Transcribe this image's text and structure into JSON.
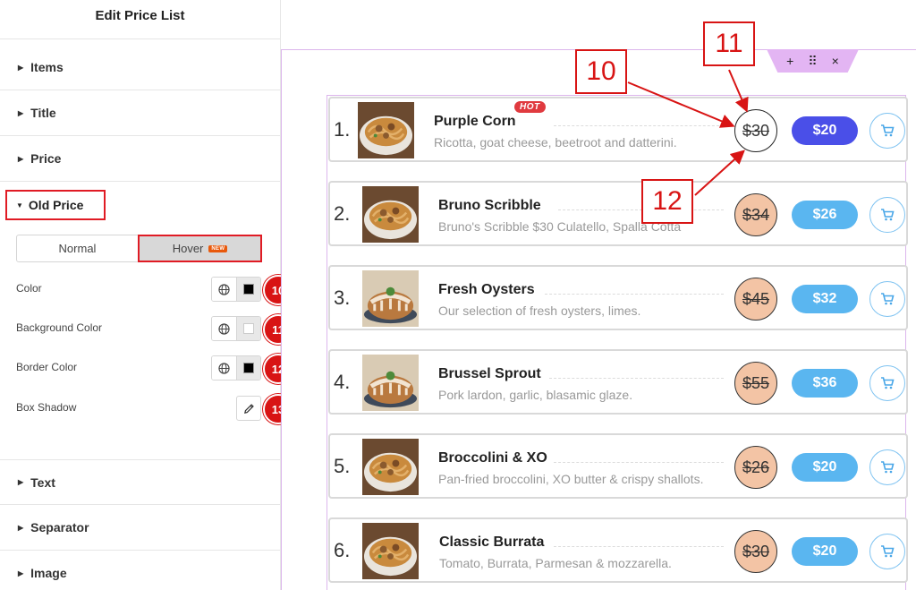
{
  "panel": {
    "title": "Edit Price List",
    "sections": {
      "items": "Items",
      "title": "Title",
      "price": "Price",
      "old_price": "Old Price",
      "text": "Text",
      "separator": "Separator",
      "image": "Image"
    },
    "tabs": {
      "normal": "Normal",
      "hover": "Hover",
      "new_badge": "NEW"
    },
    "controls": [
      {
        "label": "Color",
        "badge": "10",
        "swatch": "#000000",
        "icon": "globe-icon"
      },
      {
        "label": "Background Color",
        "badge": "11",
        "swatch": "#ffffff",
        "icon": "globe-icon"
      },
      {
        "label": "Border Color",
        "badge": "12",
        "swatch": "#000000",
        "icon": "globe-icon"
      },
      {
        "label": "Box Shadow",
        "badge": "13",
        "icon": "pencil-icon"
      }
    ]
  },
  "toolbar": {
    "add": "+",
    "move": "⠿",
    "close": "×"
  },
  "annotations": {
    "a10": "10",
    "a11": "11",
    "a12": "12"
  },
  "items": [
    {
      "num": "1.",
      "name": "Purple Corn",
      "desc": "Ricotta, goat cheese, beetroot and datterini.",
      "old_price": "$30",
      "price": "$20",
      "badge": "HOT",
      "image": "noodle-bowl"
    },
    {
      "num": "2.",
      "name": "Bruno Scribble",
      "desc": "Bruno's Scribble $30 Culatello, Spalla Cotta",
      "old_price": "$34",
      "price": "$26",
      "image": "noodle-bowl"
    },
    {
      "num": "3.",
      "name": "Fresh Oysters",
      "desc": "Our selection of fresh oysters, limes.",
      "old_price": "$45",
      "price": "$32",
      "image": "bundt-cake"
    },
    {
      "num": "4.",
      "name": "Brussel Sprout",
      "desc": "Pork lardon, garlic, blasamic glaze.",
      "old_price": "$55",
      "price": "$36",
      "image": "bundt-cake"
    },
    {
      "num": "5.",
      "name": "Broccolini & XO",
      "desc": "Pan-fried broccolini, XO butter & crispy shallots.",
      "old_price": "$26",
      "price": "$20",
      "image": "noodle-bowl"
    },
    {
      "num": "6.",
      "name": "Classic Burrata",
      "desc": "Tomato, Burrata, Parmesan & mozzarella.",
      "old_price": "$30",
      "price": "$20",
      "image": "noodle-bowl"
    }
  ],
  "colors": {
    "accent_red": "#d81414",
    "price_blue": "#5ab6f0",
    "price_blue_hover": "#4a4fe8",
    "old_price_bg": "#f3c4a5",
    "editor_purple": "#e3b5f3"
  }
}
